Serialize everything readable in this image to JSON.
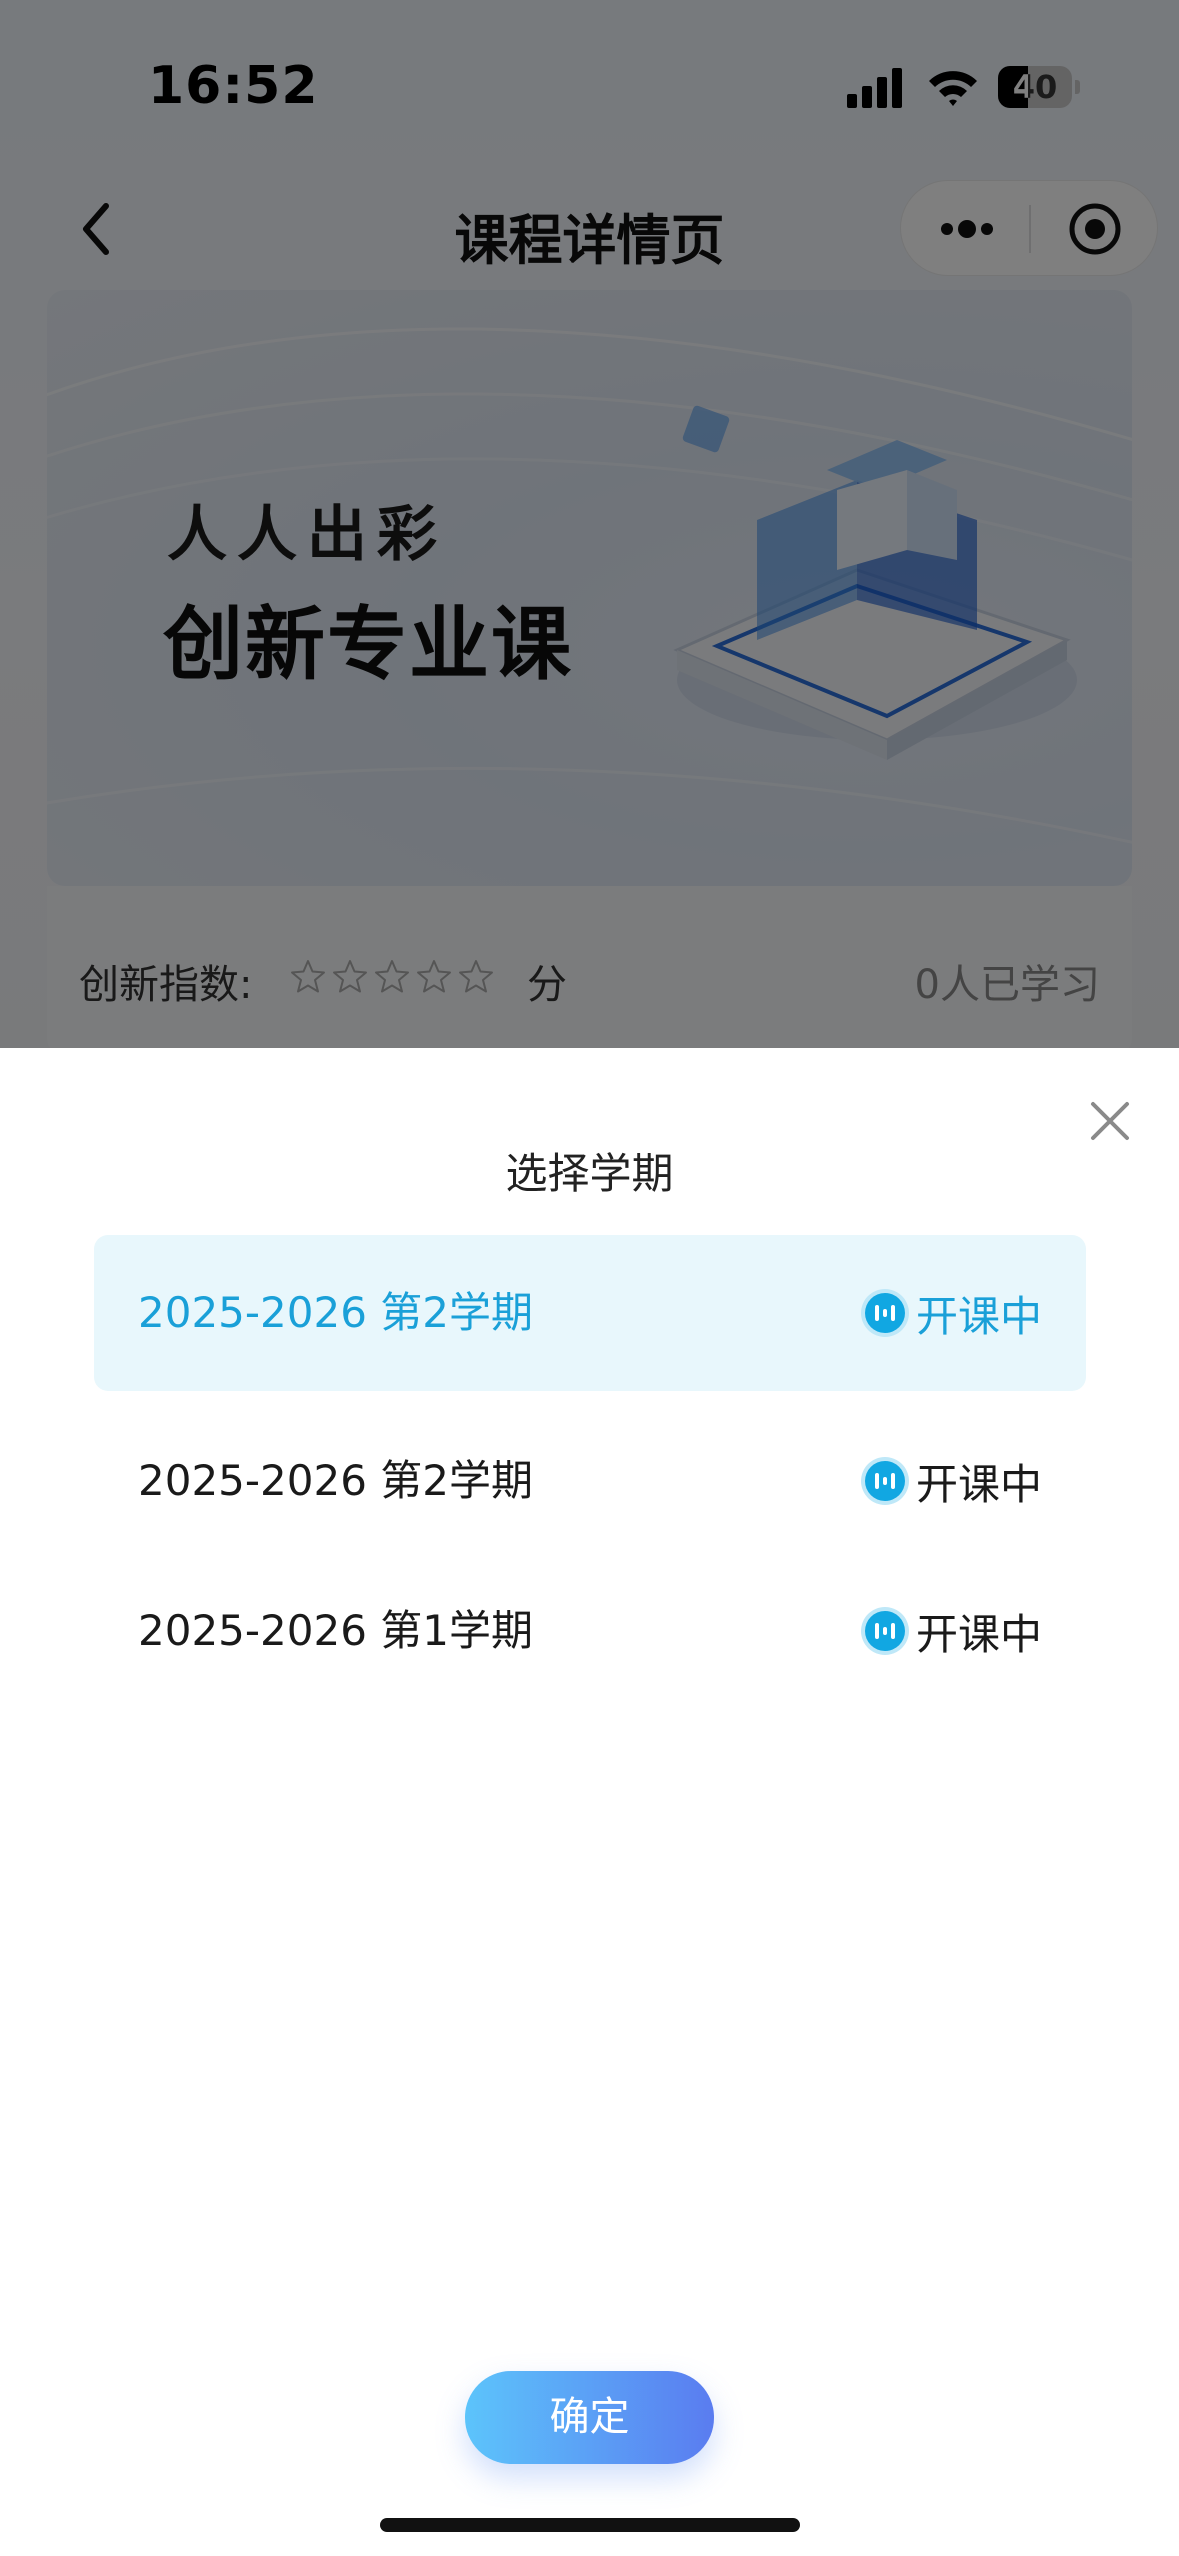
{
  "status_bar": {
    "time": "16:52",
    "battery": "40",
    "battery_level": 0.4,
    "icons": [
      "signal-icon",
      "wifi-icon",
      "battery-icon"
    ]
  },
  "nav": {
    "title": "课程详情页",
    "icons": [
      "back-icon",
      "more-icon",
      "target-icon"
    ]
  },
  "banner": {
    "line1": "人人出彩",
    "line2": "创新专业课"
  },
  "course_info": {
    "index_label": "创新指数:",
    "stars_total": 5,
    "stars_filled": 0,
    "score_unit": "分",
    "learners": "0人已学习"
  },
  "sheet": {
    "title": "选择学期",
    "terms": [
      {
        "name": "2025-2026 第2学期",
        "status": "开课中",
        "selected": true
      },
      {
        "name": "2025-2026 第2学期",
        "status": "开课中",
        "selected": false
      },
      {
        "name": "2025-2026 第1学期",
        "status": "开课中",
        "selected": false
      }
    ],
    "confirm_label": "确定"
  },
  "colors": {
    "accent": "#1aa0d8",
    "selected_bg": "#e8f7fc",
    "button_start": "#5cc4fb",
    "button_end": "#5a7cf0"
  }
}
